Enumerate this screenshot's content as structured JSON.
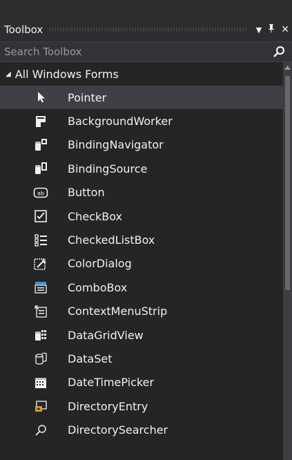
{
  "toolbox": {
    "title": "Toolbox",
    "dropdown_icon": "▼",
    "pin_icon": "ᛘ",
    "close_icon": "✕",
    "search_placeholder": "Search Toolbox",
    "group_label": "All Windows Forms",
    "items": [
      {
        "label": "Pointer",
        "icon": "pointer-icon"
      },
      {
        "label": "BackgroundWorker",
        "icon": "background-worker-icon"
      },
      {
        "label": "BindingNavigator",
        "icon": "binding-navigator-icon"
      },
      {
        "label": "BindingSource",
        "icon": "binding-source-icon"
      },
      {
        "label": "Button",
        "icon": "button-icon"
      },
      {
        "label": "CheckBox",
        "icon": "checkbox-icon"
      },
      {
        "label": "CheckedListBox",
        "icon": "checked-listbox-icon"
      },
      {
        "label": "ColorDialog",
        "icon": "color-dialog-icon"
      },
      {
        "label": "ComboBox",
        "icon": "combobox-icon"
      },
      {
        "label": "ContextMenuStrip",
        "icon": "context-menu-strip-icon"
      },
      {
        "label": "DataGridView",
        "icon": "datagridview-icon"
      },
      {
        "label": "DataSet",
        "icon": "dataset-icon"
      },
      {
        "label": "DateTimePicker",
        "icon": "datetimepicker-icon"
      },
      {
        "label": "DirectoryEntry",
        "icon": "directory-entry-icon"
      },
      {
        "label": "DirectorySearcher",
        "icon": "directory-searcher-icon"
      }
    ]
  }
}
